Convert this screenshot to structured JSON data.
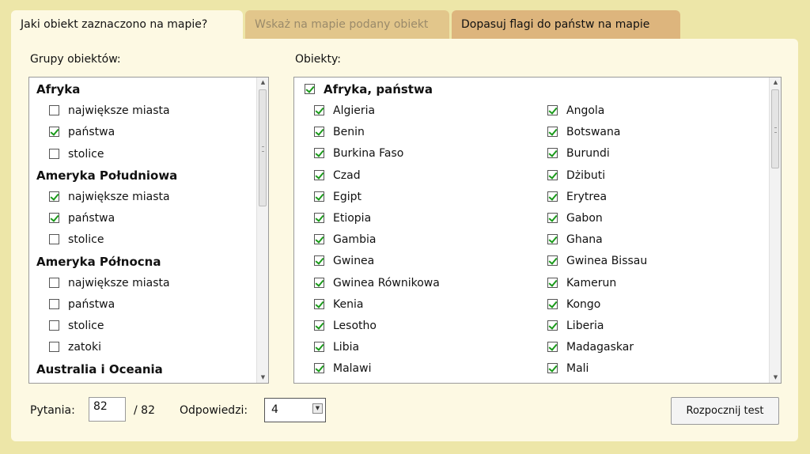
{
  "tabs": [
    {
      "label": "Jaki obiekt zaznaczono na mapie?",
      "state": "active"
    },
    {
      "label": "Wskaż na mapie podany obiekt",
      "state": "disabled"
    },
    {
      "label": "Dopasuj flagi do państw na mapie",
      "state": "normal"
    }
  ],
  "groups_label": "Grupy obiektów:",
  "objects_label": "Obiekty:",
  "groups": [
    {
      "title": "Afryka",
      "items": [
        {
          "label": "największe miasta",
          "checked": false
        },
        {
          "label": "państwa",
          "checked": true
        },
        {
          "label": "stolice",
          "checked": false
        }
      ]
    },
    {
      "title": "Ameryka Południowa",
      "items": [
        {
          "label": "największe miasta",
          "checked": true
        },
        {
          "label": "państwa",
          "checked": true
        },
        {
          "label": "stolice",
          "checked": false
        }
      ]
    },
    {
      "title": "Ameryka Północna",
      "items": [
        {
          "label": "największe miasta",
          "checked": false
        },
        {
          "label": "państwa",
          "checked": false
        },
        {
          "label": "stolice",
          "checked": false
        },
        {
          "label": "zatoki",
          "checked": false
        }
      ]
    },
    {
      "title": "Australia i Oceania",
      "items": []
    }
  ],
  "objects_header": {
    "label": "Afryka, państwa",
    "checked": true
  },
  "objects_left": [
    "Algieria",
    "Benin",
    "Burkina Faso",
    "Czad",
    "Egipt",
    "Etiopia",
    "Gambia",
    "Gwinea",
    "Gwinea Równikowa",
    "Kenia",
    "Lesotho",
    "Libia",
    "Malawi"
  ],
  "objects_right": [
    "Angola",
    "Botswana",
    "Burundi",
    "Dżibuti",
    "Erytrea",
    "Gabon",
    "Ghana",
    "Gwinea Bissau",
    "Kamerun",
    "Kongo",
    "Liberia",
    "Madagaskar",
    "Mali"
  ],
  "bottom": {
    "questions_label": "Pytania:",
    "questions_value": "82",
    "questions_total": "/ 82",
    "answers_label": "Odpowiedzi:",
    "answers_value": "4",
    "start_button": "Rozpocznij test"
  }
}
